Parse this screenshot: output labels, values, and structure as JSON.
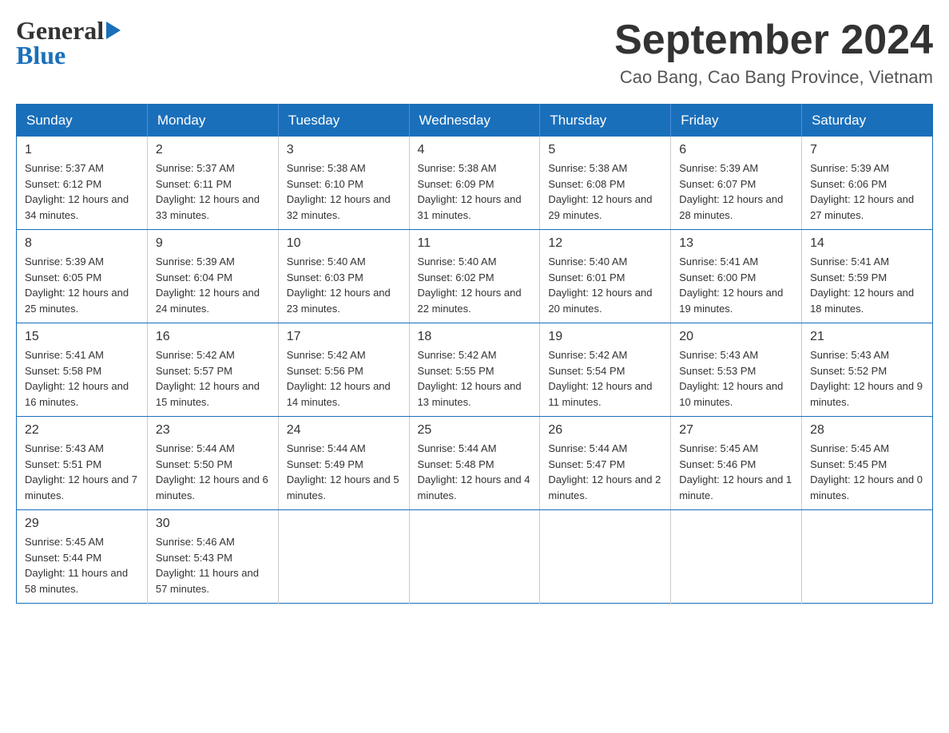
{
  "header": {
    "logo_general": "General",
    "logo_blue": "Blue",
    "title": "September 2024",
    "subtitle": "Cao Bang, Cao Bang Province, Vietnam"
  },
  "days_of_week": [
    "Sunday",
    "Monday",
    "Tuesday",
    "Wednesday",
    "Thursday",
    "Friday",
    "Saturday"
  ],
  "weeks": [
    [
      {
        "day": "1",
        "sunrise": "Sunrise: 5:37 AM",
        "sunset": "Sunset: 6:12 PM",
        "daylight": "Daylight: 12 hours and 34 minutes."
      },
      {
        "day": "2",
        "sunrise": "Sunrise: 5:37 AM",
        "sunset": "Sunset: 6:11 PM",
        "daylight": "Daylight: 12 hours and 33 minutes."
      },
      {
        "day": "3",
        "sunrise": "Sunrise: 5:38 AM",
        "sunset": "Sunset: 6:10 PM",
        "daylight": "Daylight: 12 hours and 32 minutes."
      },
      {
        "day": "4",
        "sunrise": "Sunrise: 5:38 AM",
        "sunset": "Sunset: 6:09 PM",
        "daylight": "Daylight: 12 hours and 31 minutes."
      },
      {
        "day": "5",
        "sunrise": "Sunrise: 5:38 AM",
        "sunset": "Sunset: 6:08 PM",
        "daylight": "Daylight: 12 hours and 29 minutes."
      },
      {
        "day": "6",
        "sunrise": "Sunrise: 5:39 AM",
        "sunset": "Sunset: 6:07 PM",
        "daylight": "Daylight: 12 hours and 28 minutes."
      },
      {
        "day": "7",
        "sunrise": "Sunrise: 5:39 AM",
        "sunset": "Sunset: 6:06 PM",
        "daylight": "Daylight: 12 hours and 27 minutes."
      }
    ],
    [
      {
        "day": "8",
        "sunrise": "Sunrise: 5:39 AM",
        "sunset": "Sunset: 6:05 PM",
        "daylight": "Daylight: 12 hours and 25 minutes."
      },
      {
        "day": "9",
        "sunrise": "Sunrise: 5:39 AM",
        "sunset": "Sunset: 6:04 PM",
        "daylight": "Daylight: 12 hours and 24 minutes."
      },
      {
        "day": "10",
        "sunrise": "Sunrise: 5:40 AM",
        "sunset": "Sunset: 6:03 PM",
        "daylight": "Daylight: 12 hours and 23 minutes."
      },
      {
        "day": "11",
        "sunrise": "Sunrise: 5:40 AM",
        "sunset": "Sunset: 6:02 PM",
        "daylight": "Daylight: 12 hours and 22 minutes."
      },
      {
        "day": "12",
        "sunrise": "Sunrise: 5:40 AM",
        "sunset": "Sunset: 6:01 PM",
        "daylight": "Daylight: 12 hours and 20 minutes."
      },
      {
        "day": "13",
        "sunrise": "Sunrise: 5:41 AM",
        "sunset": "Sunset: 6:00 PM",
        "daylight": "Daylight: 12 hours and 19 minutes."
      },
      {
        "day": "14",
        "sunrise": "Sunrise: 5:41 AM",
        "sunset": "Sunset: 5:59 PM",
        "daylight": "Daylight: 12 hours and 18 minutes."
      }
    ],
    [
      {
        "day": "15",
        "sunrise": "Sunrise: 5:41 AM",
        "sunset": "Sunset: 5:58 PM",
        "daylight": "Daylight: 12 hours and 16 minutes."
      },
      {
        "day": "16",
        "sunrise": "Sunrise: 5:42 AM",
        "sunset": "Sunset: 5:57 PM",
        "daylight": "Daylight: 12 hours and 15 minutes."
      },
      {
        "day": "17",
        "sunrise": "Sunrise: 5:42 AM",
        "sunset": "Sunset: 5:56 PM",
        "daylight": "Daylight: 12 hours and 14 minutes."
      },
      {
        "day": "18",
        "sunrise": "Sunrise: 5:42 AM",
        "sunset": "Sunset: 5:55 PM",
        "daylight": "Daylight: 12 hours and 13 minutes."
      },
      {
        "day": "19",
        "sunrise": "Sunrise: 5:42 AM",
        "sunset": "Sunset: 5:54 PM",
        "daylight": "Daylight: 12 hours and 11 minutes."
      },
      {
        "day": "20",
        "sunrise": "Sunrise: 5:43 AM",
        "sunset": "Sunset: 5:53 PM",
        "daylight": "Daylight: 12 hours and 10 minutes."
      },
      {
        "day": "21",
        "sunrise": "Sunrise: 5:43 AM",
        "sunset": "Sunset: 5:52 PM",
        "daylight": "Daylight: 12 hours and 9 minutes."
      }
    ],
    [
      {
        "day": "22",
        "sunrise": "Sunrise: 5:43 AM",
        "sunset": "Sunset: 5:51 PM",
        "daylight": "Daylight: 12 hours and 7 minutes."
      },
      {
        "day": "23",
        "sunrise": "Sunrise: 5:44 AM",
        "sunset": "Sunset: 5:50 PM",
        "daylight": "Daylight: 12 hours and 6 minutes."
      },
      {
        "day": "24",
        "sunrise": "Sunrise: 5:44 AM",
        "sunset": "Sunset: 5:49 PM",
        "daylight": "Daylight: 12 hours and 5 minutes."
      },
      {
        "day": "25",
        "sunrise": "Sunrise: 5:44 AM",
        "sunset": "Sunset: 5:48 PM",
        "daylight": "Daylight: 12 hours and 4 minutes."
      },
      {
        "day": "26",
        "sunrise": "Sunrise: 5:44 AM",
        "sunset": "Sunset: 5:47 PM",
        "daylight": "Daylight: 12 hours and 2 minutes."
      },
      {
        "day": "27",
        "sunrise": "Sunrise: 5:45 AM",
        "sunset": "Sunset: 5:46 PM",
        "daylight": "Daylight: 12 hours and 1 minute."
      },
      {
        "day": "28",
        "sunrise": "Sunrise: 5:45 AM",
        "sunset": "Sunset: 5:45 PM",
        "daylight": "Daylight: 12 hours and 0 minutes."
      }
    ],
    [
      {
        "day": "29",
        "sunrise": "Sunrise: 5:45 AM",
        "sunset": "Sunset: 5:44 PM",
        "daylight": "Daylight: 11 hours and 58 minutes."
      },
      {
        "day": "30",
        "sunrise": "Sunrise: 5:46 AM",
        "sunset": "Sunset: 5:43 PM",
        "daylight": "Daylight: 11 hours and 57 minutes."
      },
      null,
      null,
      null,
      null,
      null
    ]
  ]
}
